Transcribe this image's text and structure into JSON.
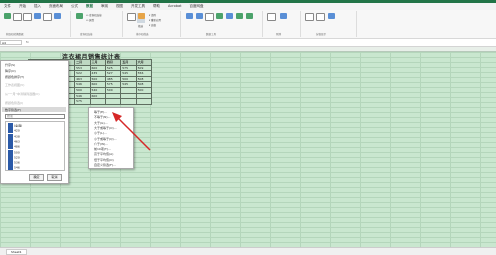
{
  "ribbon": {
    "tabs": [
      "文件",
      "开始",
      "插入",
      "页面布局",
      "公式",
      "数据",
      "审阅",
      "视图",
      "开发工具",
      "帮助",
      "Acrobat",
      "百度网盘"
    ],
    "active_tab": "数据",
    "groups": [
      {
        "label": "获取和转换数据"
      },
      {
        "label": "查询和连接"
      },
      {
        "label": "排序和筛选"
      },
      {
        "label": "数据工具"
      },
      {
        "label": "预测"
      },
      {
        "label": "分级显示"
      }
    ],
    "filter_button": "筛选"
  },
  "formula_bar": {
    "name_box": "A4",
    "fx": "fx"
  },
  "sheet": {
    "title": "连衣裙月销售统计表",
    "headers": [
      "产品",
      "品牌",
      "一月",
      "二月",
      "三月",
      "四月",
      "五月",
      "六月"
    ],
    "rows": [
      [
        "",
        "",
        "",
        "553",
        "600",
        "525",
        "575",
        "509"
      ],
      [
        "",
        "",
        "",
        "522",
        "435",
        "527",
        "545",
        "556"
      ],
      [
        "",
        "",
        "",
        "463",
        "500",
        "485",
        "500",
        "508"
      ],
      [
        "",
        "",
        "",
        "546",
        "600",
        "575",
        "545",
        "508"
      ],
      [
        "",
        "",
        "",
        "500",
        "540",
        "500",
        "",
        "500"
      ],
      [
        "",
        "",
        "",
        "546",
        "600",
        "",
        "",
        ""
      ],
      [
        "",
        "",
        "",
        "575",
        "",
        "",
        "",
        ""
      ]
    ]
  },
  "filter_dropdown": {
    "items": [
      {
        "label": "升序(S)",
        "dim": false
      },
      {
        "label": "降序(O)",
        "dim": false
      },
      {
        "label": "按颜色排序(T)",
        "dim": false
      },
      {
        "label": "工作表视图(V)",
        "dim": true
      },
      {
        "label": "从“一月”中清除筛选器(C)",
        "dim": true
      },
      {
        "label": "按颜色筛选(I)",
        "dim": true
      },
      {
        "label": "数字筛选(F)",
        "dim": false
      }
    ],
    "search_placeholder": "搜索",
    "checklist": [
      "(全选)",
      "420",
      "438",
      "463",
      "486",
      "500",
      "520",
      "536",
      "546"
    ],
    "ok": "确定",
    "cancel": "取消"
  },
  "number_filter_submenu": {
    "items": [
      "等于(E)...",
      "不等于(N)...",
      "大于(G)...",
      "大于或等于(O)...",
      "小于(L)...",
      "小于或等于(Q)...",
      "介于(W)...",
      "前10项(T)...",
      "高于平均值(A)",
      "低于平均值(O)",
      "自定义筛选(F)..."
    ]
  },
  "status": {
    "sheet_tab": "Sheet1"
  },
  "colors": {
    "accent": "#217346",
    "sheet_bg": "#c9e7cf",
    "arrow": "#d62828"
  }
}
